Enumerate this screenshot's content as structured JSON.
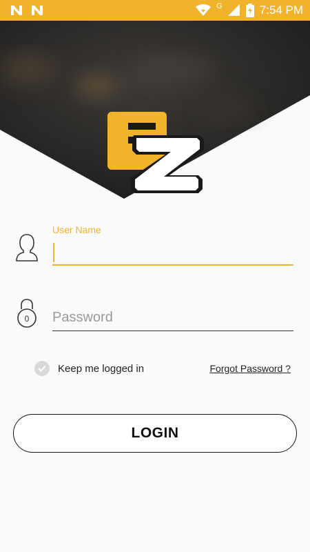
{
  "status_bar": {
    "time": "7:54 PM",
    "network_label": "G",
    "left_icons": [
      "n-notification-icon",
      "n-notification-icon"
    ],
    "right_icons": [
      "wifi-icon",
      "signal-icon",
      "battery-charging-icon"
    ]
  },
  "header": {
    "logo_letters": "ES",
    "brand_color": "#f0b32b"
  },
  "form": {
    "username": {
      "label": "User Name",
      "value": "",
      "icon": "user-icon"
    },
    "password": {
      "placeholder": "Password",
      "value": "",
      "icon": "lock-icon",
      "lock_digit": "0"
    },
    "remember": {
      "label": "Keep me logged in",
      "checked": false
    },
    "forgot_label": "Forgot Password ?",
    "login_label": "LOGIN"
  },
  "colors": {
    "accent": "#f0b32b",
    "header_dark": "#2a2826",
    "background": "#fafafa"
  }
}
